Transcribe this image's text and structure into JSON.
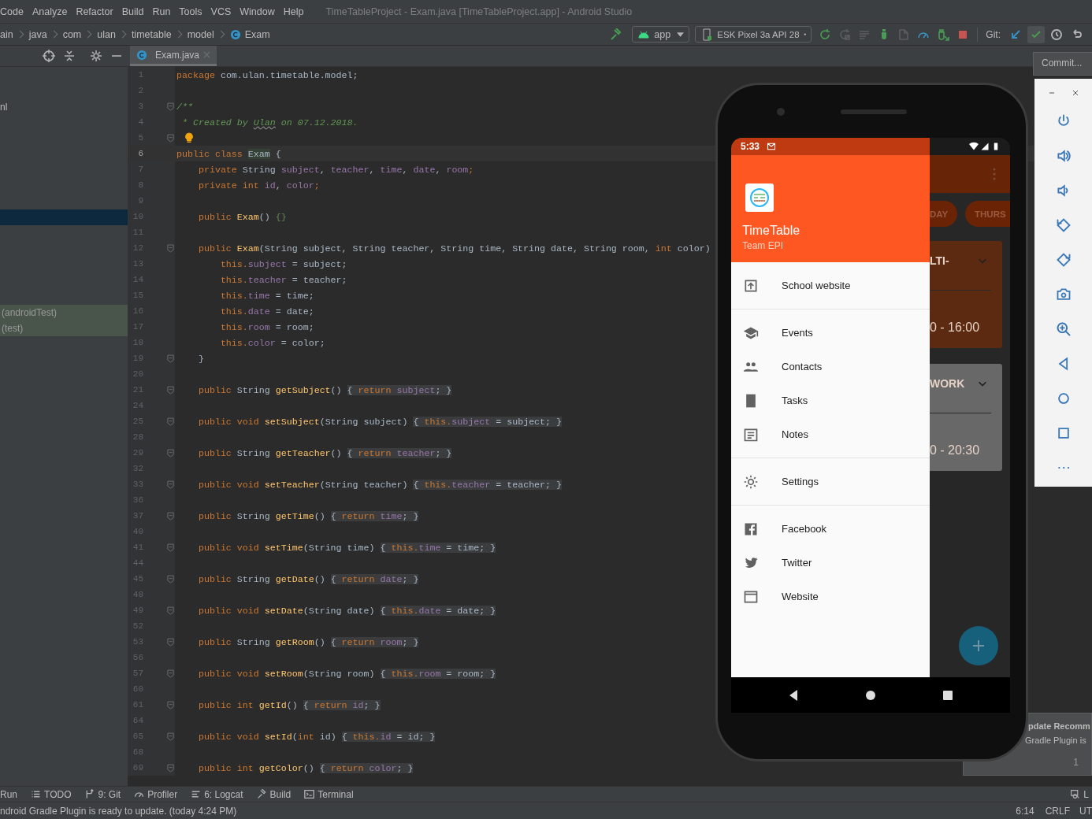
{
  "menu_bar": {
    "menus": [
      "Code",
      "Analyze",
      "Refactor",
      "Build",
      "Run",
      "Tools",
      "VCS",
      "Window",
      "Help"
    ],
    "title": "TimeTableProject - Exam.java [TimeTableProject.app] - Android Studio"
  },
  "navigation_bar": {
    "breadcrumbs": [
      {
        "kind": "folder",
        "text": "ain"
      },
      {
        "kind": "folder",
        "text": "java"
      },
      {
        "kind": "folder",
        "text": "com"
      },
      {
        "kind": "folder",
        "text": "ulan"
      },
      {
        "kind": "folder",
        "text": "timetable"
      },
      {
        "kind": "folder",
        "text": "model"
      },
      {
        "kind": "class",
        "text": "Exam"
      }
    ],
    "run_configuration": "app",
    "device": "ESK Pixel 3a API 28",
    "actions": [
      {
        "disabled": false
      },
      {
        "disabled": true
      },
      {
        "disabled": true
      },
      {
        "disabled": false
      },
      {
        "disabled": true
      },
      {
        "disabled": false
      },
      {
        "disabled": false
      },
      {
        "disabled": false
      }
    ],
    "git_label": "Git:",
    "git_actions": [
      {
        "highlighted": false
      },
      {
        "highlighted": true
      },
      {
        "highlighted": false
      },
      {
        "highlighted": false
      }
    ]
  },
  "commit_tooltip": "Commit...",
  "project_panel": {
    "rows": [
      {
        "kind": "file",
        "text": "nl",
        "selected": false
      },
      {
        "kind": "file",
        "selected": true
      },
      {
        "kind": "test",
        "text": "(androidTest)",
        "selected": false
      },
      {
        "kind": "test",
        "text": "(test)",
        "selected": false
      }
    ]
  },
  "editor": {
    "tabs": [
      {
        "label": "Exam.java",
        "selected": true
      }
    ],
    "lines": [
      {
        "number": "1",
        "current": false,
        "fold": false,
        "tokens": [
          {
            "kind": "kw",
            "text": "package "
          },
          {
            "kind": "plain",
            "text": "com.ulan.timetable.model;"
          }
        ]
      },
      {
        "number": "2",
        "current": false,
        "fold": false
      },
      {
        "number": "3",
        "current": false,
        "fold": true,
        "tokens": [
          {
            "kind": "comment",
            "text": "/**"
          }
        ]
      },
      {
        "number": "4",
        "current": false,
        "fold": false,
        "tokens": [
          {
            "kind": "comment",
            "text": " * Created by "
          },
          {
            "kind": "comment-link",
            "text": "Ulan"
          },
          {
            "kind": "comment",
            "text": " on 07.12.2018."
          }
        ]
      },
      {
        "number": "5",
        "current": false,
        "fold": true,
        "tokens": [
          {
            "kind": "bulb"
          }
        ]
      },
      {
        "number": "6",
        "current": true,
        "fold": false,
        "tokens": [
          {
            "kind": "kw",
            "text": "public class "
          },
          {
            "kind": "class-hl",
            "text": "Exam"
          },
          {
            "kind": "plain",
            "text": " {"
          }
        ]
      },
      {
        "number": "7",
        "current": false,
        "fold": false,
        "tokens": [
          {
            "kind": "kw",
            "text": "    private "
          },
          {
            "kind": "plain",
            "text": "String "
          },
          {
            "kind": "field",
            "text": "subject"
          },
          {
            "kind": "plain",
            "text": ", "
          },
          {
            "kind": "field",
            "text": "teacher"
          },
          {
            "kind": "plain",
            "text": ", "
          },
          {
            "kind": "field",
            "text": "time"
          },
          {
            "kind": "plain",
            "text": ", "
          },
          {
            "kind": "field",
            "text": "date"
          },
          {
            "kind": "plain",
            "text": ", "
          },
          {
            "kind": "field",
            "text": "room"
          },
          {
            "kind": "kw",
            "text": ";"
          }
        ]
      },
      {
        "number": "8",
        "current": false,
        "fold": false,
        "tokens": [
          {
            "kind": "kw",
            "text": "    private int "
          },
          {
            "kind": "field",
            "text": "id"
          },
          {
            "kind": "plain",
            "text": ", "
          },
          {
            "kind": "field",
            "text": "color"
          },
          {
            "kind": "kw",
            "text": ";"
          }
        ]
      },
      {
        "number": "9",
        "current": false,
        "fold": false
      },
      {
        "number": "10",
        "current": false,
        "fold": false,
        "tokens": [
          {
            "kind": "kw",
            "text": "    public "
          },
          {
            "kind": "method",
            "text": "Exam"
          },
          {
            "kind": "plain",
            "text": "() "
          },
          {
            "kind": "brace",
            "text": "{}"
          }
        ]
      },
      {
        "number": "11",
        "current": false,
        "fold": false
      },
      {
        "number": "12",
        "current": false,
        "fold": true,
        "tokens": [
          {
            "kind": "kw",
            "text": "    public "
          },
          {
            "kind": "method",
            "text": "Exam"
          },
          {
            "kind": "plain",
            "text": "(String subject, String teacher, String time, String date, String room, "
          },
          {
            "kind": "kw",
            "text": "int "
          },
          {
            "kind": "plain",
            "text": "color)"
          }
        ]
      },
      {
        "number": "13",
        "current": false,
        "fold": false,
        "tokens": [
          {
            "kind": "kw",
            "text": "        this."
          },
          {
            "kind": "field",
            "text": "subject"
          },
          {
            "kind": "plain",
            "text": " = subject;"
          }
        ]
      },
      {
        "number": "14",
        "current": false,
        "fold": false,
        "tokens": [
          {
            "kind": "kw",
            "text": "        this."
          },
          {
            "kind": "field",
            "text": "teacher"
          },
          {
            "kind": "plain",
            "text": " = teacher;"
          }
        ]
      },
      {
        "number": "15",
        "current": false,
        "fold": false,
        "tokens": [
          {
            "kind": "kw",
            "text": "        this."
          },
          {
            "kind": "field",
            "text": "time"
          },
          {
            "kind": "plain",
            "text": " = time;"
          }
        ]
      },
      {
        "number": "16",
        "current": false,
        "fold": false,
        "tokens": [
          {
            "kind": "kw",
            "text": "        this."
          },
          {
            "kind": "field",
            "text": "date"
          },
          {
            "kind": "plain",
            "text": " = date;"
          }
        ]
      },
      {
        "number": "17",
        "current": false,
        "fold": false,
        "tokens": [
          {
            "kind": "kw",
            "text": "        this."
          },
          {
            "kind": "field",
            "text": "room"
          },
          {
            "kind": "plain",
            "text": " = room;"
          }
        ]
      },
      {
        "number": "18",
        "current": false,
        "fold": false,
        "tokens": [
          {
            "kind": "kw",
            "text": "        this."
          },
          {
            "kind": "field",
            "text": "color"
          },
          {
            "kind": "plain",
            "text": " = color;"
          }
        ]
      },
      {
        "number": "19",
        "current": false,
        "fold": true,
        "tokens": [
          {
            "kind": "plain",
            "text": "    }"
          }
        ]
      },
      {
        "number": "20",
        "current": false,
        "fold": false
      },
      {
        "number": "21",
        "current": false,
        "fold": true,
        "tokens": [
          {
            "kind": "kw",
            "text": "    public "
          },
          {
            "kind": "plain",
            "text": "String "
          },
          {
            "kind": "method",
            "text": "getSubject"
          },
          {
            "kind": "plain",
            "text": "() "
          },
          {
            "kind": "fold-plain",
            "text": "{ "
          },
          {
            "kind": "fold-kw",
            "text": "return "
          },
          {
            "kind": "fold-field",
            "text": "subject"
          },
          {
            "kind": "fold-plain",
            "text": "; }"
          }
        ]
      },
      {
        "number": "24",
        "current": false,
        "fold": false
      },
      {
        "number": "25",
        "current": false,
        "fold": true,
        "tokens": [
          {
            "kind": "kw",
            "text": "    public void "
          },
          {
            "kind": "method",
            "text": "setSubject"
          },
          {
            "kind": "plain",
            "text": "(String subject) "
          },
          {
            "kind": "fold-plain",
            "text": "{ "
          },
          {
            "kind": "fold-kw",
            "text": "this."
          },
          {
            "kind": "fold-field",
            "text": "subject"
          },
          {
            "kind": "fold-plain",
            "text": " = subject; }"
          }
        ]
      },
      {
        "number": "28",
        "current": false,
        "fold": false
      },
      {
        "number": "29",
        "current": false,
        "fold": true,
        "tokens": [
          {
            "kind": "kw",
            "text": "    public "
          },
          {
            "kind": "plain",
            "text": "String "
          },
          {
            "kind": "method",
            "text": "getTeacher"
          },
          {
            "kind": "plain",
            "text": "() "
          },
          {
            "kind": "fold-plain",
            "text": "{ "
          },
          {
            "kind": "fold-kw",
            "text": "return "
          },
          {
            "kind": "fold-field",
            "text": "teacher"
          },
          {
            "kind": "fold-plain",
            "text": "; }"
          }
        ]
      },
      {
        "number": "32",
        "current": false,
        "fold": false
      },
      {
        "number": "33",
        "current": false,
        "fold": true,
        "tokens": [
          {
            "kind": "kw",
            "text": "    public void "
          },
          {
            "kind": "method",
            "text": "setTeacher"
          },
          {
            "kind": "plain",
            "text": "(String teacher) "
          },
          {
            "kind": "fold-plain",
            "text": "{ "
          },
          {
            "kind": "fold-kw",
            "text": "this."
          },
          {
            "kind": "fold-field",
            "text": "teacher"
          },
          {
            "kind": "fold-plain",
            "text": " = teacher; }"
          }
        ]
      },
      {
        "number": "36",
        "current": false,
        "fold": false
      },
      {
        "number": "37",
        "current": false,
        "fold": true,
        "tokens": [
          {
            "kind": "kw",
            "text": "    public "
          },
          {
            "kind": "plain",
            "text": "String "
          },
          {
            "kind": "method",
            "text": "getTime"
          },
          {
            "kind": "plain",
            "text": "() "
          },
          {
            "kind": "fold-plain",
            "text": "{ "
          },
          {
            "kind": "fold-kw",
            "text": "return "
          },
          {
            "kind": "fold-field",
            "text": "time"
          },
          {
            "kind": "fold-plain",
            "text": "; }"
          }
        ]
      },
      {
        "number": "40",
        "current": false,
        "fold": false
      },
      {
        "number": "41",
        "current": false,
        "fold": true,
        "tokens": [
          {
            "kind": "kw",
            "text": "    public void "
          },
          {
            "kind": "method",
            "text": "setTime"
          },
          {
            "kind": "plain",
            "text": "(String time) "
          },
          {
            "kind": "fold-plain",
            "text": "{ "
          },
          {
            "kind": "fold-kw",
            "text": "this."
          },
          {
            "kind": "fold-field",
            "text": "time"
          },
          {
            "kind": "fold-plain",
            "text": " = time; }"
          }
        ]
      },
      {
        "number": "44",
        "current": false,
        "fold": false
      },
      {
        "number": "45",
        "current": false,
        "fold": true,
        "tokens": [
          {
            "kind": "kw",
            "text": "    public "
          },
          {
            "kind": "plain",
            "text": "String "
          },
          {
            "kind": "method",
            "text": "getDate"
          },
          {
            "kind": "plain",
            "text": "() "
          },
          {
            "kind": "fold-plain",
            "text": "{ "
          },
          {
            "kind": "fold-kw",
            "text": "return "
          },
          {
            "kind": "fold-field",
            "text": "date"
          },
          {
            "kind": "fold-plain",
            "text": "; }"
          }
        ]
      },
      {
        "number": "48",
        "current": false,
        "fold": false
      },
      {
        "number": "49",
        "current": false,
        "fold": true,
        "tokens": [
          {
            "kind": "kw",
            "text": "    public void "
          },
          {
            "kind": "method",
            "text": "setDate"
          },
          {
            "kind": "plain",
            "text": "(String date) "
          },
          {
            "kind": "fold-plain",
            "text": "{ "
          },
          {
            "kind": "fold-kw",
            "text": "this."
          },
          {
            "kind": "fold-field",
            "text": "date"
          },
          {
            "kind": "fold-plain",
            "text": " = date; }"
          }
        ]
      },
      {
        "number": "52",
        "current": false,
        "fold": false
      },
      {
        "number": "53",
        "current": false,
        "fold": true,
        "tokens": [
          {
            "kind": "kw",
            "text": "    public "
          },
          {
            "kind": "plain",
            "text": "String "
          },
          {
            "kind": "method",
            "text": "getRoom"
          },
          {
            "kind": "plain",
            "text": "() "
          },
          {
            "kind": "fold-plain",
            "text": "{ "
          },
          {
            "kind": "fold-kw",
            "text": "return "
          },
          {
            "kind": "fold-field",
            "text": "room"
          },
          {
            "kind": "fold-plain",
            "text": "; }"
          }
        ]
      },
      {
        "number": "56",
        "current": false,
        "fold": false
      },
      {
        "number": "57",
        "current": false,
        "fold": true,
        "tokens": [
          {
            "kind": "kw",
            "text": "    public void "
          },
          {
            "kind": "method",
            "text": "setRoom"
          },
          {
            "kind": "plain",
            "text": "(String room) "
          },
          {
            "kind": "fold-plain",
            "text": "{ "
          },
          {
            "kind": "fold-kw",
            "text": "this."
          },
          {
            "kind": "fold-field",
            "text": "room"
          },
          {
            "kind": "fold-plain",
            "text": " = room; }"
          }
        ]
      },
      {
        "number": "60",
        "current": false,
        "fold": false
      },
      {
        "number": "61",
        "current": false,
        "fold": true,
        "tokens": [
          {
            "kind": "kw",
            "text": "    public int "
          },
          {
            "kind": "method",
            "text": "getId"
          },
          {
            "kind": "plain",
            "text": "() "
          },
          {
            "kind": "fold-plain",
            "text": "{ "
          },
          {
            "kind": "fold-kw",
            "text": "return "
          },
          {
            "kind": "fold-field",
            "text": "id"
          },
          {
            "kind": "fold-plain",
            "text": "; }"
          }
        ]
      },
      {
        "number": "64",
        "current": false,
        "fold": false
      },
      {
        "number": "65",
        "current": false,
        "fold": true,
        "tokens": [
          {
            "kind": "kw",
            "text": "    public void "
          },
          {
            "kind": "method",
            "text": "setId"
          },
          {
            "kind": "plain",
            "text": "("
          },
          {
            "kind": "kw",
            "text": "int "
          },
          {
            "kind": "plain",
            "text": "id) "
          },
          {
            "kind": "fold-plain",
            "text": "{ "
          },
          {
            "kind": "fold-kw",
            "text": "this."
          },
          {
            "kind": "fold-field",
            "text": "id"
          },
          {
            "kind": "fold-plain",
            "text": " = id; }"
          }
        ]
      },
      {
        "number": "68",
        "current": false,
        "fold": false
      },
      {
        "number": "69",
        "current": false,
        "fold": true,
        "tokens": [
          {
            "kind": "kw",
            "text": "    public int "
          },
          {
            "kind": "method",
            "text": "getColor"
          },
          {
            "kind": "plain",
            "text": "() "
          },
          {
            "kind": "fold-plain",
            "text": "{ "
          },
          {
            "kind": "fold-kw",
            "text": "return "
          },
          {
            "kind": "fold-field",
            "text": "color"
          },
          {
            "kind": "fold-plain",
            "text": "; }"
          }
        ]
      }
    ]
  },
  "emulator": {
    "status_time": "5:33",
    "app_title": "TimeTable",
    "app_subtitle": "Team EPI",
    "drawer_groups": [
      {
        "items": [
          {
            "label": "School website"
          }
        ]
      },
      {
        "items": [
          {
            "label": "Events"
          },
          {
            "label": "Contacts"
          },
          {
            "label": "Tasks"
          },
          {
            "label": "Notes"
          }
        ]
      },
      {
        "items": [
          {
            "label": "Settings"
          }
        ]
      },
      {
        "items": [
          {
            "label": "Facebook"
          },
          {
            "label": "Twitter"
          },
          {
            "label": "Website"
          }
        ]
      }
    ],
    "background_tabs": [
      "DAY",
      "THURS"
    ],
    "background_cards": [
      {
        "title": "LTI-",
        "time": "0 - 16:00",
        "color": "#5c2a10"
      },
      {
        "title": "WORK",
        "time": "0 - 20:30",
        "color": "#686868"
      }
    ]
  },
  "notification": {
    "title": "pdate Recomm",
    "body": "Gradle Plugin is",
    "footer": "1"
  },
  "tool_windows": [
    {
      "label": "Run"
    },
    {
      "label": "TODO"
    },
    {
      "label": "9: Git"
    },
    {
      "label": "Profiler"
    },
    {
      "label": "6: Logcat"
    },
    {
      "label": "Build"
    },
    {
      "label": "Terminal"
    }
  ],
  "event_log": "L",
  "status_bar": {
    "message": "ndroid Gradle Plugin is ready to update. (today 4:24 PM)",
    "position": "6:14",
    "line_separator": "CRLF",
    "encoding": "UT"
  }
}
